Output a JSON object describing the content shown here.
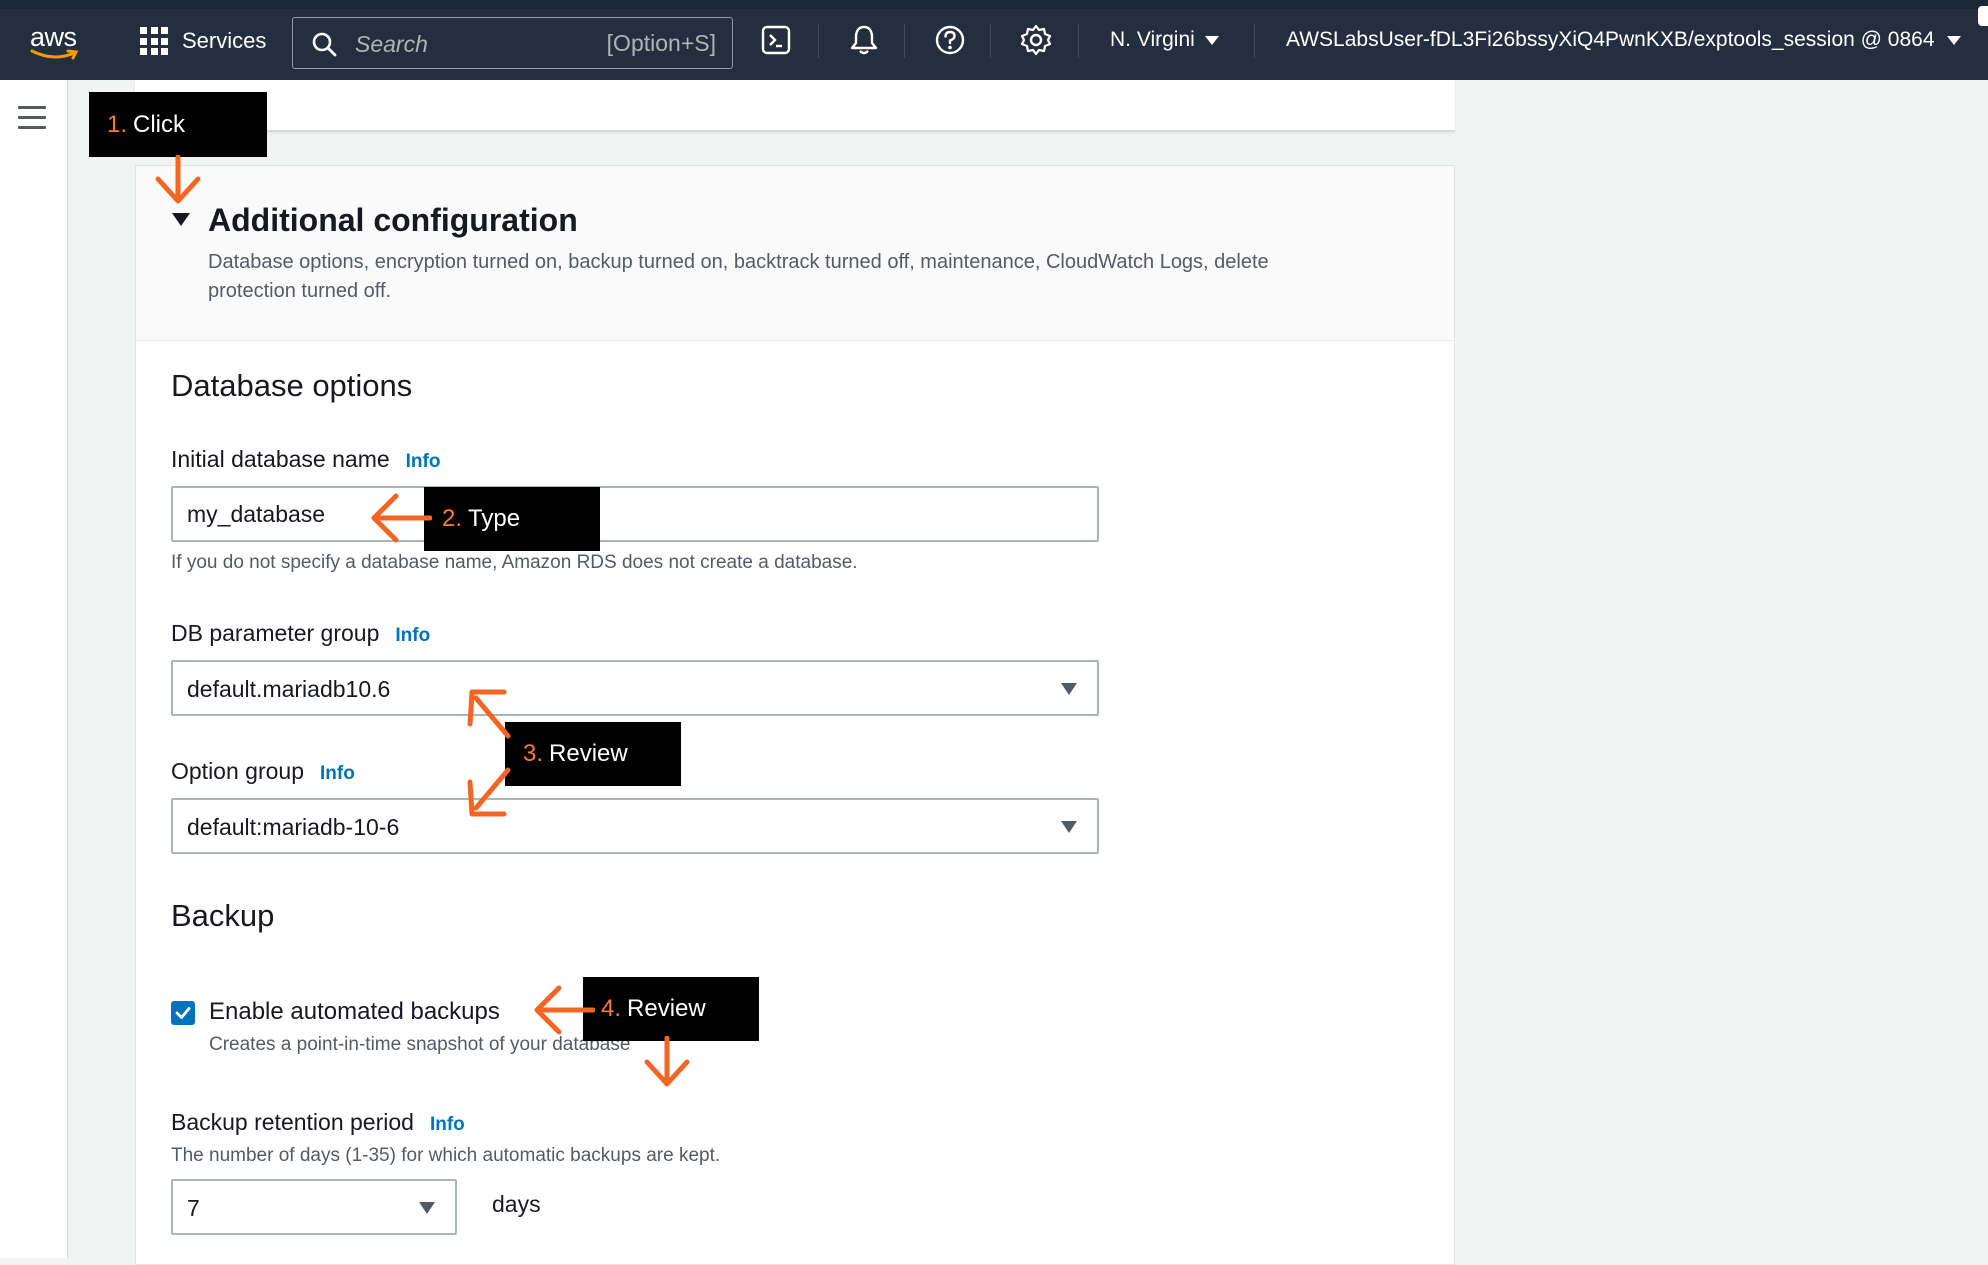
{
  "nav": {
    "logo_text": "aws",
    "services_label": "Services",
    "search_placeholder": "Search",
    "search_shortcut": "[Option+S]",
    "region": "N. Virgini",
    "account": "AWSLabsUser-fDL3Fi26bssyXiQ4PwnKXB/exptools_session @ 0864"
  },
  "section": {
    "title": "Additional configuration",
    "description": "Database options, encryption turned on, backup turned on, backtrack turned off, maintenance, CloudWatch Logs, delete protection turned off."
  },
  "database_options": {
    "heading": "Database options",
    "initial_db_label": "Initial database name",
    "initial_db_value": "my_database",
    "initial_db_hint": "If you do not specify a database name, Amazon RDS does not create a database.",
    "param_group_label": "DB parameter group",
    "param_group_value": "default.mariadb10.6",
    "option_group_label": "Option group",
    "option_group_value": "default:mariadb-10-6",
    "info_label": "Info"
  },
  "backup": {
    "heading": "Backup",
    "enable_label": "Enable automated backups",
    "enable_checked": true,
    "enable_hint": "Creates a point-in-time snapshot of your database",
    "retention_label": "Backup retention period",
    "retention_hint": "The number of days (1-35) for which automatic backups are kept.",
    "retention_value": "7",
    "retention_unit": "days"
  },
  "callouts": [
    {
      "num": "1.",
      "text": "Click"
    },
    {
      "num": "2.",
      "text": "Type"
    },
    {
      "num": "3.",
      "text": "Review"
    },
    {
      "num": "4.",
      "text": "Review"
    }
  ],
  "colors": {
    "nav_bg": "#232f3e",
    "accent": "#0073bb",
    "callout_bg": "#000000",
    "callout_number": "#ff7a2f",
    "arrow": "#f26522"
  }
}
